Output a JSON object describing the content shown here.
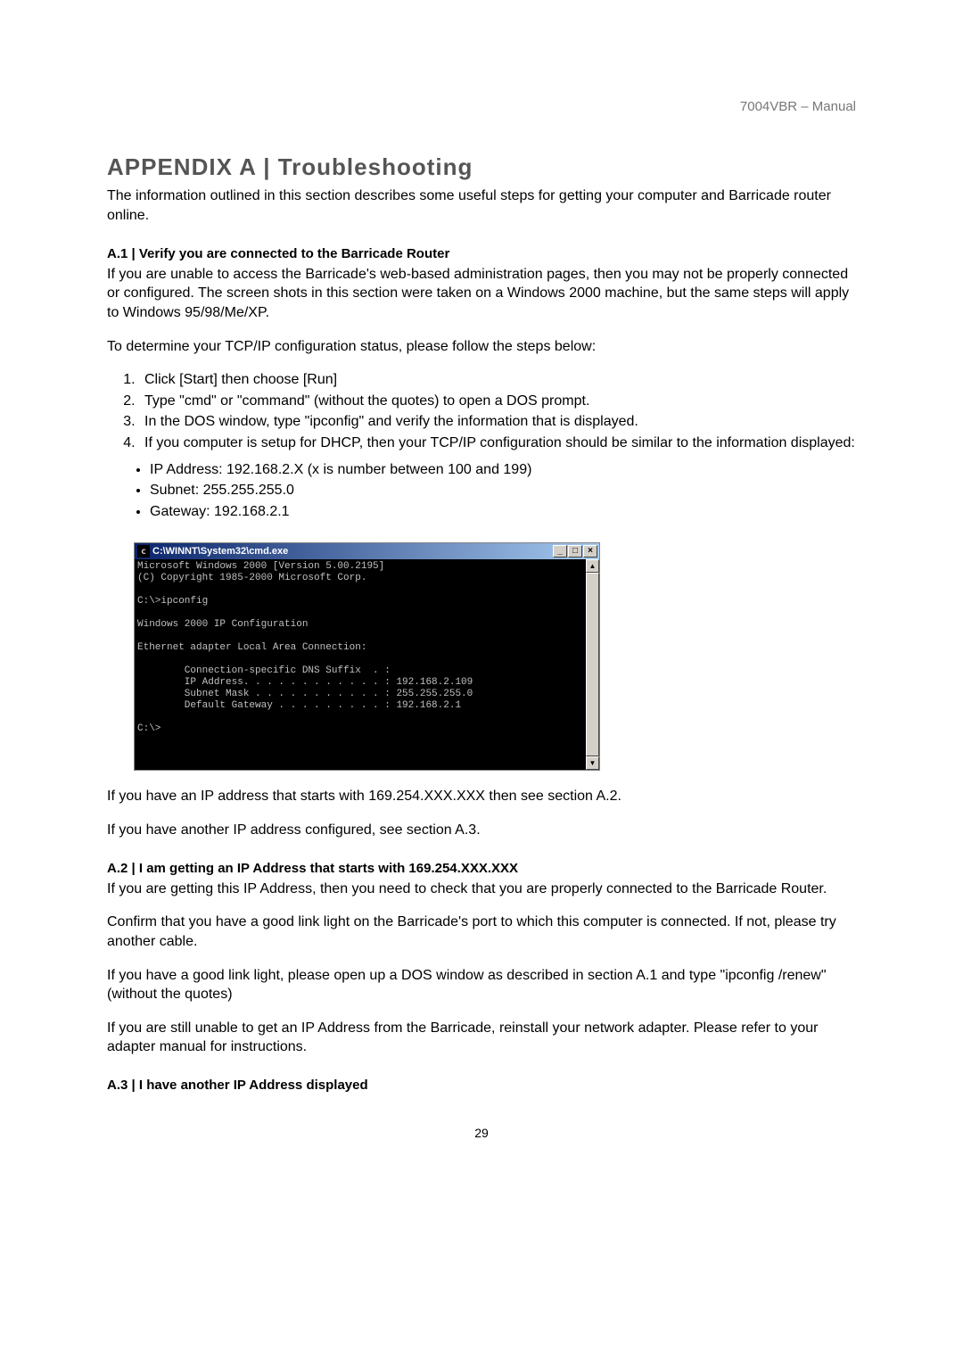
{
  "header": {
    "doc_title": "7004VBR – Manual"
  },
  "title": "APPENDIX A | Troubleshooting",
  "intro": "The information outlined in this section describes some useful steps for getting your computer and Barricade router online.",
  "a1": {
    "heading": "A.1 | Verify you are connected to the Barricade Router",
    "p1": "If you are unable to access the Barricade's web-based administration pages, then you may not be properly connected or configured. The screen shots in this section were taken on a Windows 2000 machine, but the same steps will apply to Windows 95/98/Me/XP.",
    "p2": "To determine your TCP/IP configuration status, please follow the steps below:",
    "steps": [
      "Click [Start] then choose [Run]",
      "Type \"cmd\" or \"command\" (without the quotes) to open a DOS prompt.",
      "In the DOS window, type \"ipconfig\" and verify the information that is displayed.",
      "If you computer is setup for DHCP, then your TCP/IP configuration should be similar to the information displayed:"
    ],
    "bullets": [
      "IP Address: 192.168.2.X (x is number between 100 and 199)",
      "Subnet: 255.255.255.0",
      "Gateway: 192.168.2.1"
    ],
    "after1": "If you have an IP address that starts with 169.254.XXX.XXX then see section A.2.",
    "after2": "If you have another IP address configured, see section A.3."
  },
  "cmd": {
    "title": "C:\\WINNT\\System32\\cmd.exe",
    "icon_glyph": "c",
    "minimize": "_",
    "maximize": "□",
    "close": "×",
    "scroll_up": "▲",
    "scroll_down": "▼",
    "content": "Microsoft Windows 2000 [Version 5.00.2195]\n(C) Copyright 1985-2000 Microsoft Corp.\n\nC:\\>ipconfig\n\nWindows 2000 IP Configuration\n\nEthernet adapter Local Area Connection:\n\n        Connection-specific DNS Suffix  . :\n        IP Address. . . . . . . . . . . . : 192.168.2.109\n        Subnet Mask . . . . . . . . . . . : 255.255.255.0\n        Default Gateway . . . . . . . . . : 192.168.2.1\n\nC:\\>"
  },
  "a2": {
    "heading": "A.2 | I am getting an IP Address that starts with 169.254.XXX.XXX",
    "p1": "If you are getting this IP Address, then you need to check that you are properly connected to the Barricade Router.",
    "p2": "Confirm that you have a good link light on the Barricade's port to which this computer is connected. If not, please try another cable.",
    "p3": "If you have a good link light, please open up a DOS window as described in section A.1 and type \"ipconfig /renew\" (without the quotes)",
    "p4": "If you are still unable to get an IP Address from the Barricade, reinstall your network adapter. Please refer to your adapter manual for instructions."
  },
  "a3": {
    "heading": "A.3 | I have another IP Address displayed"
  },
  "page_number": "29"
}
